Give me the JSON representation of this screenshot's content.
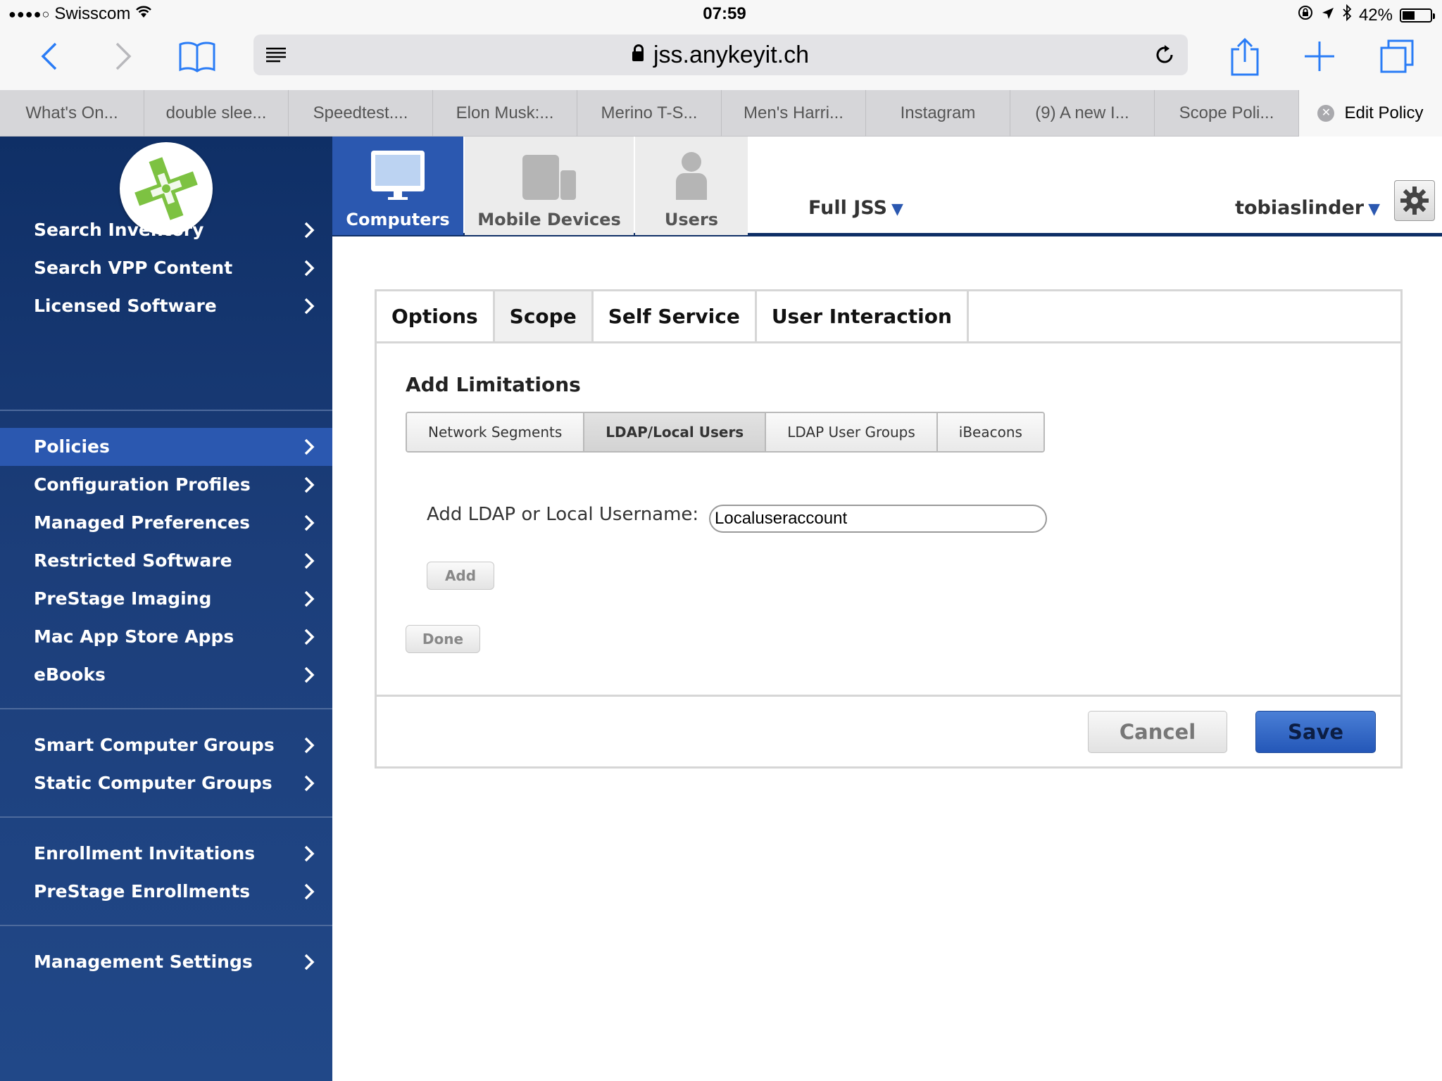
{
  "status_bar": {
    "carrier": "Swisscom",
    "time": "07:59",
    "battery": "42%"
  },
  "browser": {
    "url": "jss.anykeyit.ch",
    "tabs": [
      {
        "label": "What's On..."
      },
      {
        "label": "double slee..."
      },
      {
        "label": "Speedtest...."
      },
      {
        "label": "Elon Musk:..."
      },
      {
        "label": "Merino T-S..."
      },
      {
        "label": "Men's Harri..."
      },
      {
        "label": "Instagram"
      },
      {
        "label": "(9) A new I..."
      },
      {
        "label": "Scope Poli..."
      },
      {
        "label": "Edit Policy"
      }
    ]
  },
  "topnav": {
    "computers": "Computers",
    "mobile_devices": "Mobile Devices",
    "users": "Users",
    "site": "Full JSS",
    "account": "tobiaslinder"
  },
  "sidebar": {
    "group1": [
      "Search Inventory",
      "Search VPP Content",
      "Licensed Software"
    ],
    "group2": [
      "Policies",
      "Configuration Profiles",
      "Managed Preferences",
      "Restricted Software",
      "PreStage Imaging",
      "Mac App Store Apps",
      "eBooks"
    ],
    "group3": [
      "Smart Computer Groups",
      "Static Computer Groups"
    ],
    "group4": [
      "Enrollment Invitations",
      "PreStage Enrollments"
    ],
    "group5": [
      "Management Settings"
    ]
  },
  "policy": {
    "tabs": [
      "Options",
      "Scope",
      "Self Service",
      "User Interaction"
    ],
    "section_title": "Add Limitations",
    "segments": [
      "Network Segments",
      "LDAP/Local Users",
      "LDAP User Groups",
      "iBeacons"
    ],
    "ldap_label": "Add LDAP or Local Username:",
    "ldap_value": "Localuseraccount",
    "add_label": "Add",
    "done_label": "Done",
    "cancel_label": "Cancel",
    "save_label": "Save"
  },
  "colors": {
    "sidebar_top": "#0f2f66",
    "accent_blue": "#2b58b0",
    "logo_green": "#7dc242"
  }
}
